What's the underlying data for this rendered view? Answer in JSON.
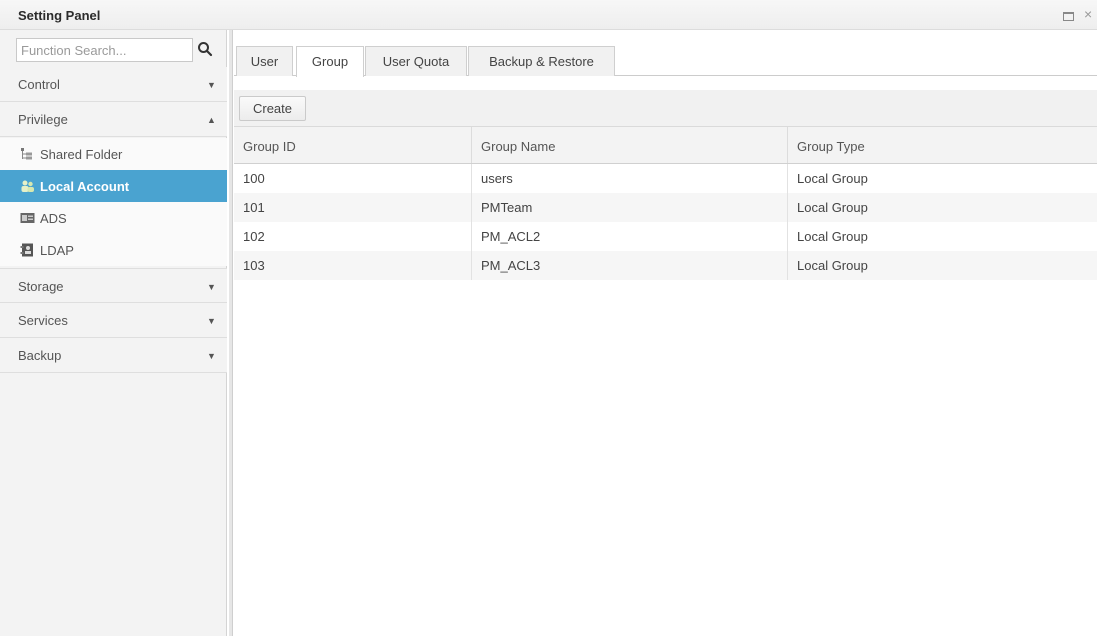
{
  "window": {
    "title": "Setting Panel",
    "restore_icon": "restore-icon",
    "close_glyph": "×"
  },
  "sidebar": {
    "search": {
      "placeholder": "Function Search...",
      "value": ""
    },
    "categories": [
      {
        "label": "Control",
        "expanded": false
      },
      {
        "label": "Privilege",
        "expanded": true,
        "items": [
          {
            "label": "Shared Folder",
            "icon": "folder-tree-icon",
            "active": false
          },
          {
            "label": "Local Account",
            "icon": "users-icon",
            "active": true
          },
          {
            "label": "ADS",
            "icon": "ads-card-icon",
            "active": false
          },
          {
            "label": "LDAP",
            "icon": "ldap-directory-icon",
            "active": false
          }
        ]
      },
      {
        "label": "Storage",
        "expanded": false
      },
      {
        "label": "Services",
        "expanded": false
      },
      {
        "label": "Backup",
        "expanded": false
      }
    ],
    "arrow_down": "▼",
    "arrow_up": "▲"
  },
  "main": {
    "tabs": [
      {
        "label": "User",
        "active": false
      },
      {
        "label": "Group",
        "active": true
      },
      {
        "label": "User Quota",
        "active": false
      },
      {
        "label": "Backup & Restore",
        "active": false
      }
    ],
    "toolbar": {
      "create_label": "Create"
    },
    "table": {
      "columns": [
        "Group ID",
        "Group Name",
        "Group Type"
      ],
      "rows": [
        [
          "100",
          "users",
          "Local Group"
        ],
        [
          "101",
          "PMTeam",
          "Local Group"
        ],
        [
          "102",
          "PM_ACL2",
          "Local Group"
        ],
        [
          "103",
          "PM_ACL3",
          "Local Group"
        ]
      ]
    }
  },
  "colors": {
    "accent": "#4aa3d0",
    "sidebar_bg": "#f3f3f3",
    "header_bg": "#f3f3f3"
  }
}
